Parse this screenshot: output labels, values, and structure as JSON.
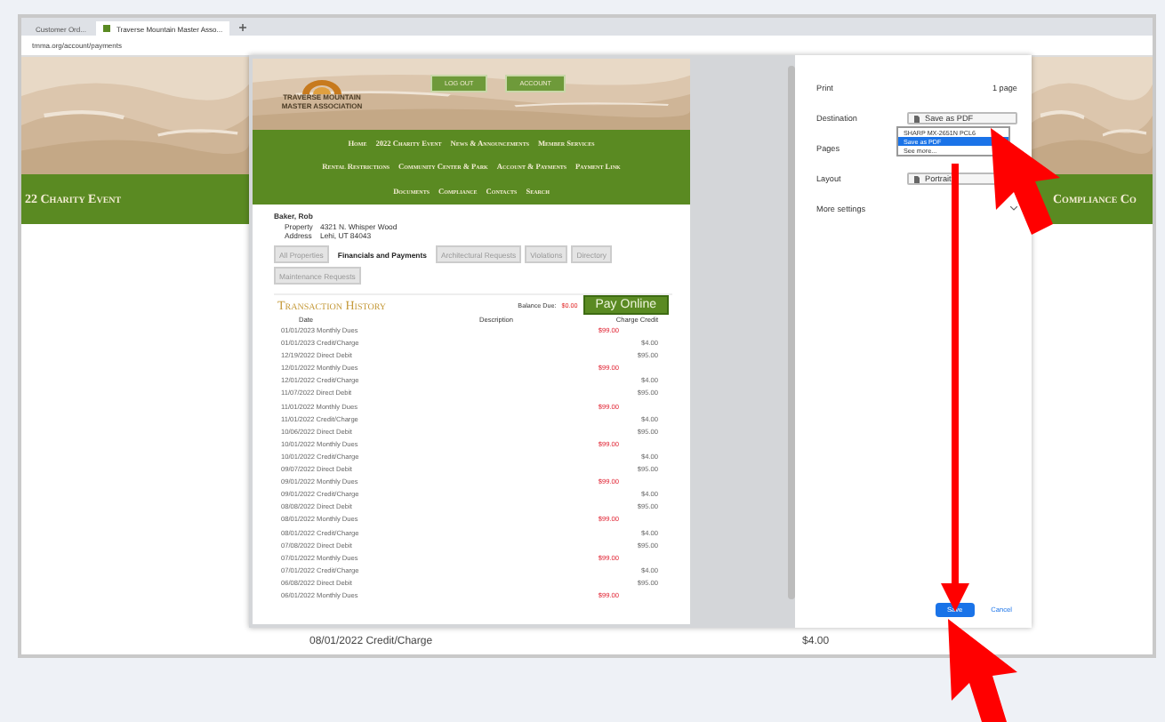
{
  "browser": {
    "tabs": [
      {
        "title": "Customer Ord...",
        "selected": false
      },
      {
        "title": "Traverse Mountain Master Asso...",
        "selected": true
      }
    ],
    "address": "tmma.org/account/payments"
  },
  "background_page": {
    "left_nav_item": "22 Charity Event",
    "right_nav_item": "Compliance Co",
    "bottom_row": "08/01/2022 Credit/Charge",
    "bottom_amount": "$4.00"
  },
  "print_preview": {
    "logo_text": "TRAVERSE MOUNTAIN MASTER ASSOCIATION",
    "header_buttons": [
      "LOG OUT",
      "ACCOUNT"
    ],
    "nav_lines": [
      [
        "Home",
        "2022 Charity Event",
        "News & Announcements",
        "Member Services"
      ],
      [
        "Rental Restrictions",
        "Community Center & Park",
        "Account & Payments",
        "Payment Link"
      ],
      [
        "Documents",
        "Compliance",
        "Contacts",
        "Search"
      ]
    ],
    "owner": "Baker, Rob",
    "property_label": "Property",
    "property": "4321 N. Whisper Wood",
    "address_label": "Address",
    "address": "Lehi, UT 84043",
    "tabs": [
      {
        "label": "All Properties",
        "selected": false
      },
      {
        "label": "Financials and Payments",
        "selected": true
      },
      {
        "label": "Architectural Requests",
        "selected": false
      },
      {
        "label": "Violations",
        "selected": false
      },
      {
        "label": "Directory",
        "selected": false
      },
      {
        "label": "Maintenance Requests",
        "selected": false
      }
    ],
    "balance_label": "Balance Due:",
    "balance": "$0.00",
    "pay_button": "Pay Online",
    "history_title": "Transaction History",
    "columns": [
      "Date",
      "Description",
      "Charge Credit"
    ],
    "rows": [
      {
        "date": "01/01/2023",
        "description": "Monthly Dues",
        "amount": "$99.00",
        "kind": "charge"
      },
      {
        "date": "01/01/2023",
        "description": "Credit/Charge",
        "amount": "$4.00",
        "kind": "credit"
      },
      {
        "date": "12/19/2022",
        "description": "Direct Debit",
        "amount": "$95.00",
        "kind": "credit"
      },
      {
        "date": "12/01/2022",
        "description": "Monthly Dues",
        "amount": "$99.00",
        "kind": "charge"
      },
      {
        "date": "12/01/2022",
        "description": "Credit/Charge",
        "amount": "$4.00",
        "kind": "credit"
      },
      {
        "date": "11/07/2022",
        "description": "Direct Debit",
        "amount": "$95.00",
        "kind": "credit"
      },
      {
        "date": "11/01/2022",
        "description": "Monthly Dues",
        "amount": "$99.00",
        "kind": "charge"
      },
      {
        "date": "11/01/2022",
        "description": "Credit/Charge",
        "amount": "$4.00",
        "kind": "credit"
      },
      {
        "date": "10/06/2022",
        "description": "Direct Debit",
        "amount": "$95.00",
        "kind": "credit"
      },
      {
        "date": "10/01/2022",
        "description": "Monthly Dues",
        "amount": "$99.00",
        "kind": "charge"
      },
      {
        "date": "10/01/2022",
        "description": "Credit/Charge",
        "amount": "$4.00",
        "kind": "credit"
      },
      {
        "date": "09/07/2022",
        "description": "Direct Debit",
        "amount": "$95.00",
        "kind": "credit"
      },
      {
        "date": "09/01/2022",
        "description": "Monthly Dues",
        "amount": "$99.00",
        "kind": "charge"
      },
      {
        "date": "09/01/2022",
        "description": "Credit/Charge",
        "amount": "$4.00",
        "kind": "credit"
      },
      {
        "date": "08/08/2022",
        "description": "Direct Debit",
        "amount": "$95.00",
        "kind": "credit"
      },
      {
        "date": "08/01/2022",
        "description": "Monthly Dues",
        "amount": "$99.00",
        "kind": "charge"
      },
      {
        "date": "08/01/2022",
        "description": "Credit/Charge",
        "amount": "$4.00",
        "kind": "credit"
      },
      {
        "date": "07/08/2022",
        "description": "Direct Debit",
        "amount": "$95.00",
        "kind": "credit"
      },
      {
        "date": "07/01/2022",
        "description": "Monthly Dues",
        "amount": "$99.00",
        "kind": "charge"
      },
      {
        "date": "07/01/2022",
        "description": "Credit/Charge",
        "amount": "$4.00",
        "kind": "credit"
      },
      {
        "date": "06/08/2022",
        "description": "Direct Debit",
        "amount": "$95.00",
        "kind": "credit"
      },
      {
        "date": "06/01/2022",
        "description": "Monthly Dues",
        "amount": "$99.00",
        "kind": "charge"
      }
    ]
  },
  "print_settings": {
    "title": "Print",
    "pages_count": "1 page",
    "fields": [
      {
        "label": "Destination",
        "value": "Save as PDF",
        "kind": "select"
      },
      {
        "label": "Pages",
        "kind": "none"
      },
      {
        "label": "Layout",
        "value": "Portrait",
        "kind": "select"
      },
      {
        "label": "More settings",
        "kind": "expander"
      }
    ],
    "dropdown_options": [
      {
        "label": "SHARP MX-2651N PCL6",
        "selected": false
      },
      {
        "label": "Save as PDF",
        "selected": true
      },
      {
        "label": "See more...",
        "selected": false
      }
    ],
    "buttons": [
      {
        "label": "Save",
        "kind": "primary"
      },
      {
        "label": "Cancel",
        "kind": "secondary"
      }
    ]
  }
}
